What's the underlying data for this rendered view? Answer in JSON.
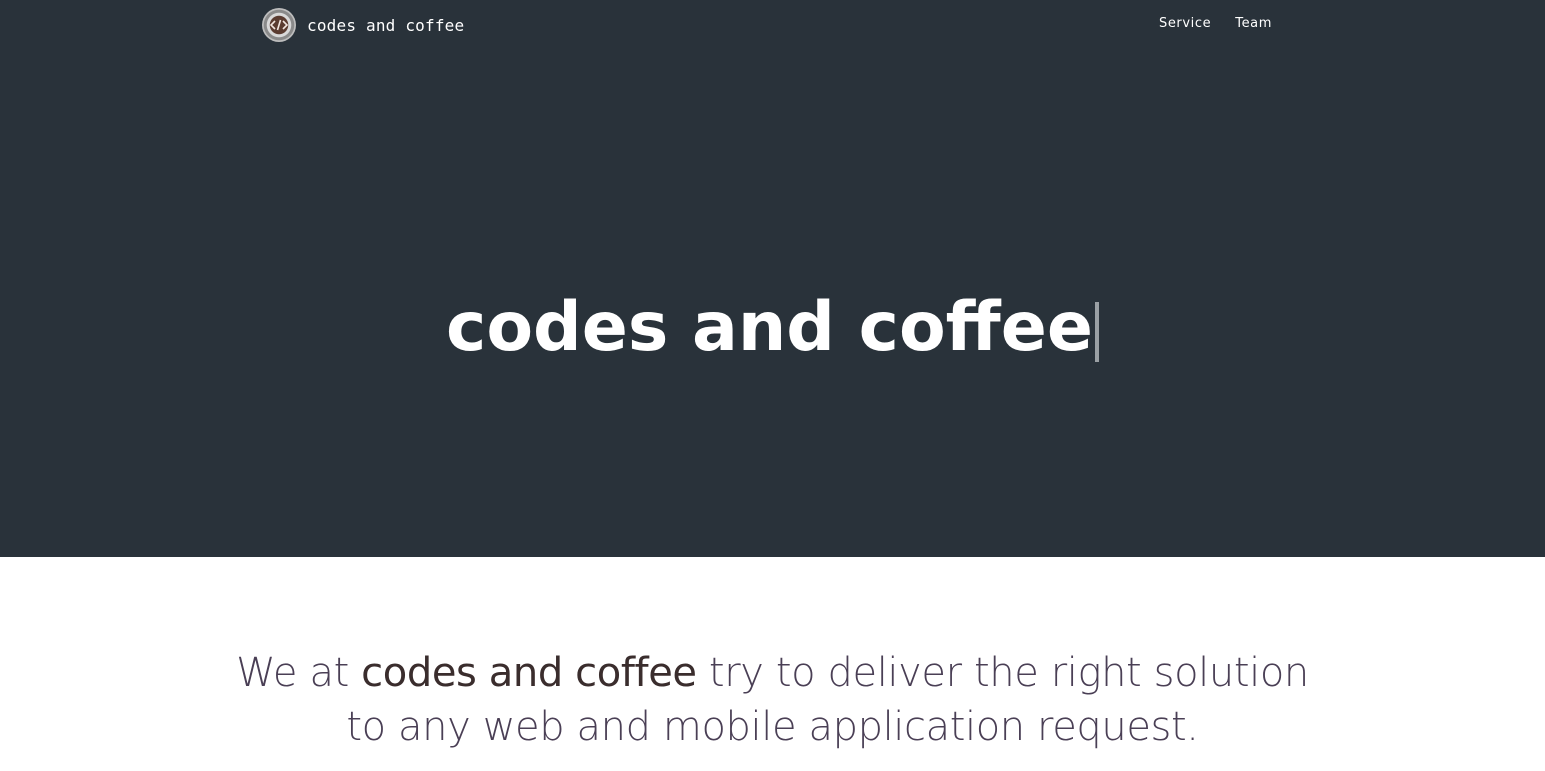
{
  "navbar": {
    "brand_name": "codes and coffee",
    "links": [
      {
        "label": "Service"
      },
      {
        "label": "Team"
      }
    ],
    "logo_icon": "coffee-code-logo-icon"
  },
  "hero": {
    "title": "codes and coffee",
    "background_color": "#29323a"
  },
  "intro": {
    "prefix": "We at ",
    "company": "codes and coffee",
    "line1_suffix": " try to deliver the right solution",
    "line2": "to any web and mobile application request."
  }
}
